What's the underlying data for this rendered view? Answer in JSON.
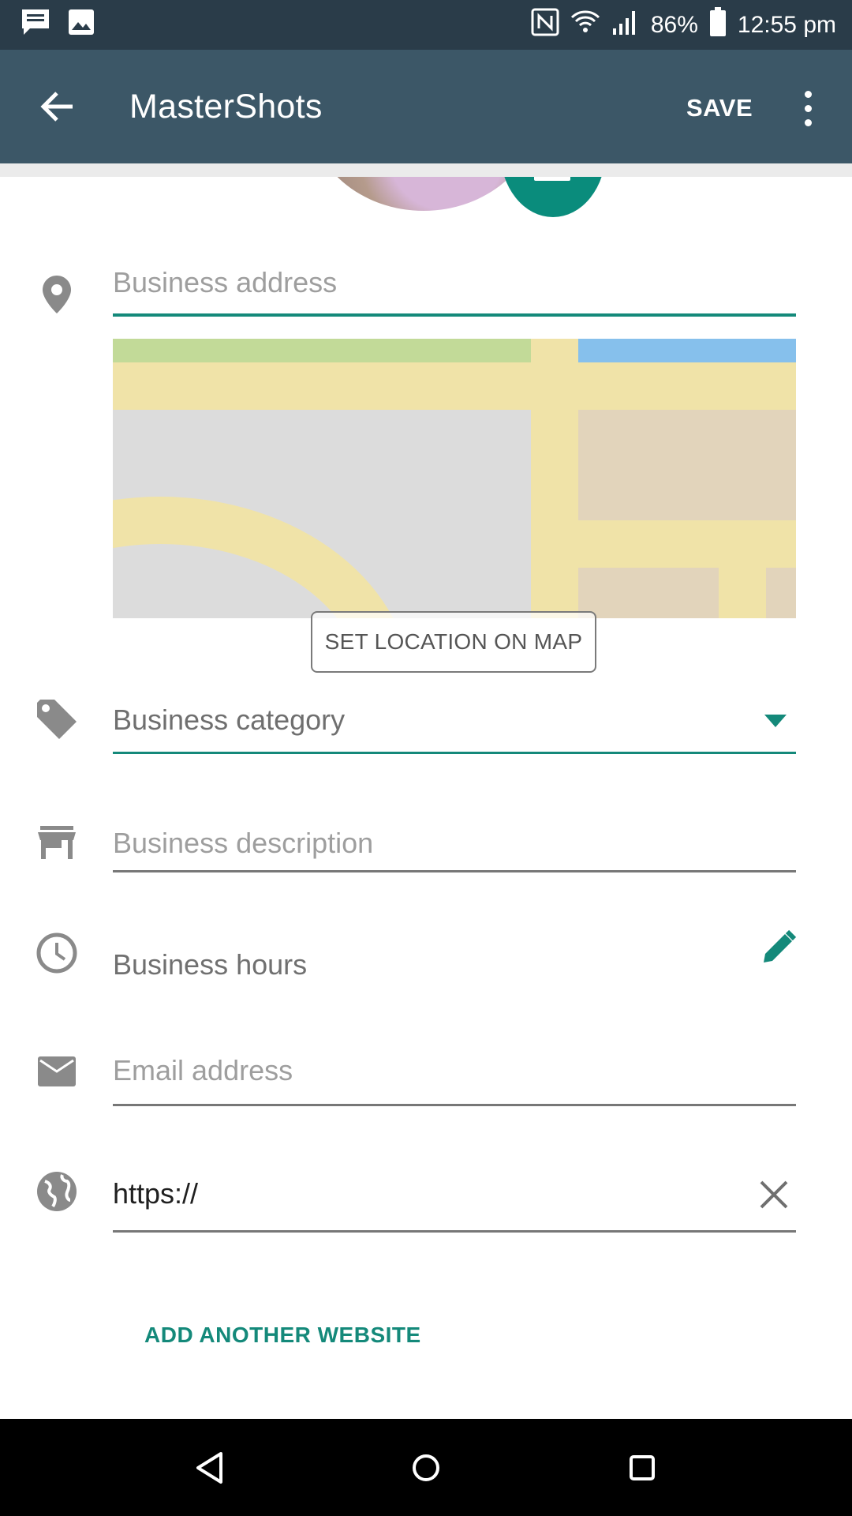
{
  "status_bar": {
    "battery": "86%",
    "time": "12:55 pm",
    "icons": [
      "message-icon",
      "image-icon",
      "nfc-icon",
      "wifi-icon",
      "signal-icon",
      "battery-icon"
    ]
  },
  "app_bar": {
    "title": "MasterShots",
    "save_label": "SAVE",
    "back_icon": "arrow-back-icon",
    "more_icon": "more-vert-icon"
  },
  "form": {
    "address": {
      "placeholder": "Business address",
      "icon": "location-pin-icon"
    },
    "map": {
      "button_label": "SET LOCATION ON MAP"
    },
    "category": {
      "value": "Business category",
      "icon": "tag-icon"
    },
    "description": {
      "placeholder": "Business description",
      "icon": "store-icon"
    },
    "hours": {
      "label": "Business hours",
      "icon": "clock-icon",
      "edit_icon": "pencil-icon"
    },
    "email": {
      "placeholder": "Email address",
      "icon": "mail-icon"
    },
    "website": {
      "value": "https://",
      "icon": "globe-icon",
      "clear_icon": "close-icon"
    },
    "add_website_label": "ADD ANOTHER WEBSITE"
  },
  "colors": {
    "status_bar": "#2a3c49",
    "app_bar": "#3c5767",
    "accent": "#14897a"
  },
  "nav_bar": {
    "icons": [
      "back-triangle-icon",
      "home-circle-icon",
      "recents-square-icon"
    ]
  }
}
